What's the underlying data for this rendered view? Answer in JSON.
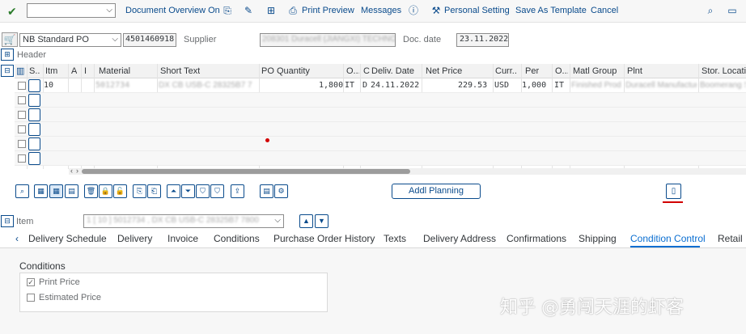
{
  "toolbar": {
    "document_overview": "Document Overview On",
    "print_preview": "Print Preview",
    "messages": "Messages",
    "personal_setting": "Personal Setting",
    "save_as_template": "Save As Template",
    "cancel": "Cancel"
  },
  "header": {
    "po_type": "NB Standard PO",
    "po_number": "4501460918",
    "supplier_label": "Supplier",
    "supplier_value": "208301 Duracell (JIANGXI) TECHNO...",
    "doc_date_label": "Doc. date",
    "doc_date_value": "23.11.2022",
    "header_label": "Header"
  },
  "grid": {
    "columns": [
      "S...",
      "Itm",
      "A",
      "I",
      "Material",
      "Short Text",
      "PO Quantity",
      "O...",
      "C",
      "Deliv. Date",
      "Net Price",
      "Curr...",
      "Per",
      "O...",
      "Matl Group",
      "Plnt",
      "Stor. Location"
    ],
    "rows": [
      {
        "itm": "10",
        "material": "5012734",
        "short_text": "DX CB USB-C 28325B7 7",
        "qty": "1,800",
        "oun": "IT",
        "c": "D",
        "deliv_date": "24.11.2022",
        "net_price": "229.53",
        "curr": "USD",
        "per": "1,000",
        "opu": "IT",
        "matl_group": "Finished Prod",
        "plnt": "Duracell Manufactur",
        "stor_location": "Boomerang S"
      }
    ]
  },
  "grid_toolbar": {
    "addl_planning": "Addl Planning"
  },
  "item": {
    "label": "Item",
    "selected": "1 [ 10 ] 5012734 , DX CB USB-C 28325B7 7800"
  },
  "tabs": [
    "Delivery Schedule",
    "Delivery",
    "Invoice",
    "Conditions",
    "Purchase Order History",
    "Texts",
    "Delivery Address",
    "Confirmations",
    "Shipping",
    "Condition Control",
    "Retail"
  ],
  "active_tab": "Condition Control",
  "conditions": {
    "title": "Conditions",
    "print_price": "Print Price",
    "print_price_checked": true,
    "estimated_price": "Estimated Price",
    "estimated_price_checked": false
  },
  "watermark": "知乎 @勇闯天涯的虾客",
  "colors": {
    "accent": "#0a6ed1",
    "link": "#0a4b8c",
    "marker": "#d20000"
  }
}
